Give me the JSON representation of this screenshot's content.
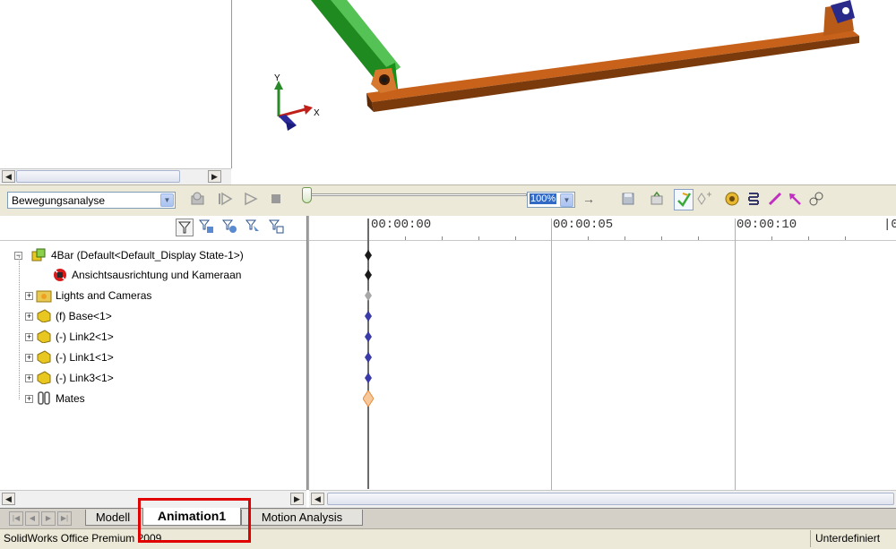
{
  "study": {
    "selected": "Bewegungsanalyse"
  },
  "zoom": {
    "value": "100%"
  },
  "tree": {
    "items": [
      {
        "label": "4Bar  (Default<Default_Display State-1>)"
      },
      {
        "label": "Ansichtsausrichtung und Kameraan"
      },
      {
        "label": "Lights and Cameras"
      },
      {
        "label": "(f) Base<1>"
      },
      {
        "label": "(-) Link2<1>"
      },
      {
        "label": "(-) Link1<1>"
      },
      {
        "label": "(-) Link3<1>"
      },
      {
        "label": "Mates"
      }
    ]
  },
  "timeline": {
    "times": [
      "00:00:00",
      "00:00:05",
      "00:00:10",
      "|0"
    ]
  },
  "triad": {
    "x_label": "X",
    "y_label": "Y"
  },
  "tabs": [
    {
      "label": "Modell"
    },
    {
      "label": "Animation1"
    },
    {
      "label": "Motion Analysis"
    }
  ],
  "status": {
    "left_text": "SolidWorks Office Premium 2009",
    "right_text": "Unterdefiniert"
  },
  "colors": {
    "highlight": "#e00000",
    "link_green": "#1f8a1f",
    "link_orange": "#c8621a",
    "keyframe_blue": "#3a3aa8"
  }
}
